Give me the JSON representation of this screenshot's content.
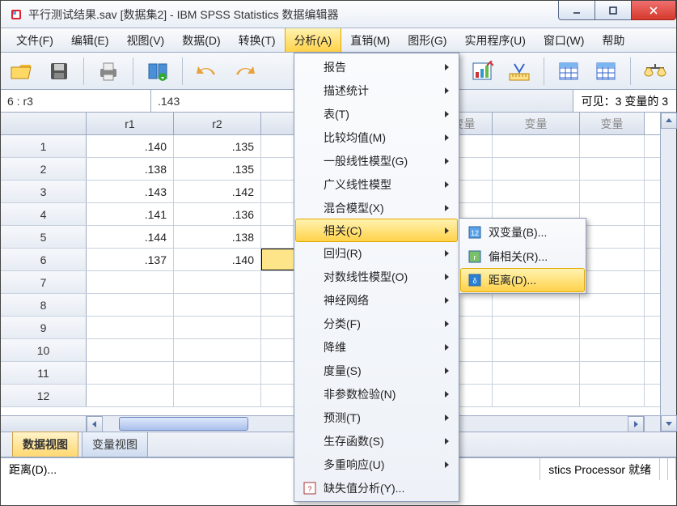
{
  "title": "平行测试结果.sav [数据集2] - IBM SPSS Statistics 数据编辑器",
  "menus": {
    "file": "文件(F)",
    "edit": "编辑(E)",
    "view": "视图(V)",
    "data": "数据(D)",
    "transform": "转换(T)",
    "analyze": "分析(A)",
    "dm": "直销(M)",
    "graphs": "图形(G)",
    "utilities": "实用程序(U)",
    "window": "窗口(W)",
    "help": "帮助"
  },
  "cellref": "6 : r3",
  "cellval": ".143",
  "visible": "可见：3 变量的 3",
  "columns": {
    "r1": "r1",
    "r2": "r2",
    "var": "变量"
  },
  "rows": [
    {
      "n": "1",
      "r1": ".140",
      "r2": ".135"
    },
    {
      "n": "2",
      "r1": ".138",
      "r2": ".135"
    },
    {
      "n": "3",
      "r1": ".143",
      "r2": ".142"
    },
    {
      "n": "4",
      "r1": ".141",
      "r2": ".136"
    },
    {
      "n": "5",
      "r1": ".144",
      "r2": ".138"
    },
    {
      "n": "6",
      "r1": ".137",
      "r2": ".140"
    },
    {
      "n": "7",
      "r1": "",
      "r2": ""
    },
    {
      "n": "8",
      "r1": "",
      "r2": ""
    },
    {
      "n": "9",
      "r1": "",
      "r2": ""
    },
    {
      "n": "10",
      "r1": "",
      "r2": ""
    },
    {
      "n": "11",
      "r1": "",
      "r2": ""
    },
    {
      "n": "12",
      "r1": "",
      "r2": ""
    }
  ],
  "tabs": {
    "data": "数据视图",
    "var": "变量视图"
  },
  "status": {
    "left": "距离(D)...",
    "mid": "缺失值分析(Y)...",
    "right": "stics Processor 就绪"
  },
  "analyze_menu": [
    {
      "label": "报告",
      "sub": true
    },
    {
      "label": "描述统计",
      "sub": true
    },
    {
      "label": "表(T)",
      "sub": true
    },
    {
      "label": "比较均值(M)",
      "sub": true
    },
    {
      "label": "一般线性模型(G)",
      "sub": true
    },
    {
      "label": "广义线性模型",
      "sub": true
    },
    {
      "label": "混合模型(X)",
      "sub": true
    },
    {
      "label": "相关(C)",
      "sub": true,
      "hl": true
    },
    {
      "label": "回归(R)",
      "sub": true
    },
    {
      "label": "对数线性模型(O)",
      "sub": true
    },
    {
      "label": "神经网络",
      "sub": true
    },
    {
      "label": "分类(F)",
      "sub": true
    },
    {
      "label": "降维",
      "sub": true
    },
    {
      "label": "度量(S)",
      "sub": true
    },
    {
      "label": "非参数检验(N)",
      "sub": true
    },
    {
      "label": "预测(T)",
      "sub": true
    },
    {
      "label": "生存函数(S)",
      "sub": true
    },
    {
      "label": "多重响应(U)",
      "sub": true
    },
    {
      "label": "缺失值分析(Y)...",
      "sub": false,
      "icon": "missing"
    }
  ],
  "correlate_submenu": [
    {
      "label": "双变量(B)...",
      "icon": "biv"
    },
    {
      "label": "偏相关(R)...",
      "icon": "partial"
    },
    {
      "label": "距离(D)...",
      "icon": "dist",
      "hl": true
    }
  ]
}
